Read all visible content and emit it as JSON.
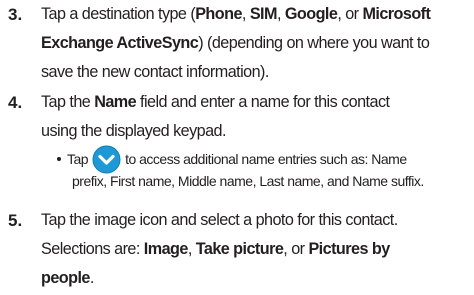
{
  "steps": [
    {
      "number": "3.",
      "lines": [
        [
          "Tap a destination type (",
          "Phone",
          ", ",
          "SIM",
          ", ",
          "Google",
          ", or ",
          "Microsoft"
        ],
        [
          "Exchange ActiveSync",
          ") (depending on where you want to"
        ],
        [
          "save the new contact information)."
        ]
      ]
    },
    {
      "number": "4.",
      "lines": [
        [
          "Tap the ",
          "Name",
          " field and enter a name for this contact"
        ],
        [
          "using the displayed keypad."
        ]
      ],
      "bullet": {
        "before_icon": "Tap",
        "icon": "chevron-down-circle-icon",
        "icon_color": "#1d9ad6",
        "after_icon": "to access additional name entries such as: Name",
        "continuation": "prefix, First name, Middle name, Last name, and Name suffix."
      }
    },
    {
      "number": "5.",
      "lines": [
        [
          "Tap the image icon and select a photo for this contact."
        ],
        [
          "Selections are: ",
          "Image",
          ", ",
          "Take picture",
          ", or ",
          "Pictures by"
        ],
        [
          "people",
          "."
        ]
      ]
    }
  ]
}
